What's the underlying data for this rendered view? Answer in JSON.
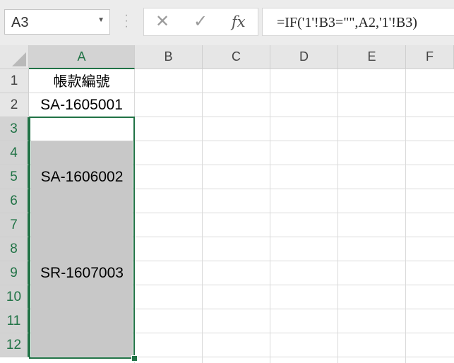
{
  "formula_bar": {
    "name_box": "A3",
    "cancel_icon": "✕",
    "enter_icon": "✓",
    "insert_function_label": "fx",
    "formula": "=IF('1'!B3=\"\",A2,'1'!B3)"
  },
  "columns": [
    "A",
    "B",
    "C",
    "D",
    "E",
    "F"
  ],
  "rows": [
    "1",
    "2",
    "3",
    "4",
    "5",
    "6",
    "7",
    "8",
    "9",
    "10",
    "11",
    "12"
  ],
  "cells": {
    "A1": "帳款編號",
    "A2": "SA-1605001",
    "A5": "SA-1606002",
    "A9": "SR-1607003"
  },
  "selection": {
    "active_cell": "A3",
    "range": "A3:A12"
  },
  "colors": {
    "accent": "#217346",
    "selection_fill": "#c8c8c8",
    "header_bg": "#e6e6e6",
    "grid_line": "#dadada"
  }
}
